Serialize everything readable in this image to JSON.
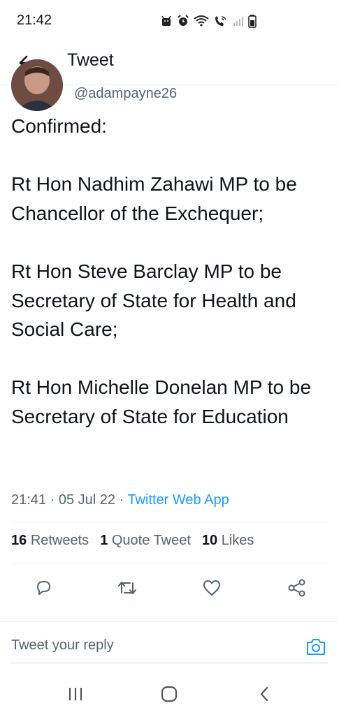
{
  "status_bar": {
    "time": "21:42",
    "icons": [
      "android-icon",
      "alarm-icon",
      "wifi-icon",
      "wifi-calling-icon",
      "signal-icon",
      "battery-icon"
    ]
  },
  "header": {
    "title": "Tweet",
    "back_icon": "arrow-left-icon"
  },
  "tweet": {
    "handle": "@adampayne26",
    "text": "Confirmed:\n\nRt Hon Nadhim Zahawi MP to be Chancellor of the Exchequer;\n\nRt Hon Steve Barclay MP to be Secretary of State for Health and Social Care;\n\nRt Hon Michelle Donelan MP to be Secretary of State for Education",
    "time": "21:41",
    "date": "05 Jul 22",
    "source": "Twitter Web App",
    "separator": " · "
  },
  "stats": {
    "retweets_count": "16",
    "retweets_label": "Retweets",
    "quotes_count": "1",
    "quotes_label": "Quote Tweet",
    "likes_count": "10",
    "likes_label": "Likes"
  },
  "actions": [
    "reply-icon",
    "retweet-icon",
    "like-icon",
    "share-icon"
  ],
  "reply_bar": {
    "placeholder": "Tweet your reply",
    "camera_icon": "camera-icon"
  },
  "nav_bar": {
    "buttons": [
      "recent-apps-icon",
      "home-icon",
      "back-icon"
    ]
  },
  "colors": {
    "accent": "#1d9bf0",
    "text": "#0f1419",
    "muted": "#536471"
  }
}
